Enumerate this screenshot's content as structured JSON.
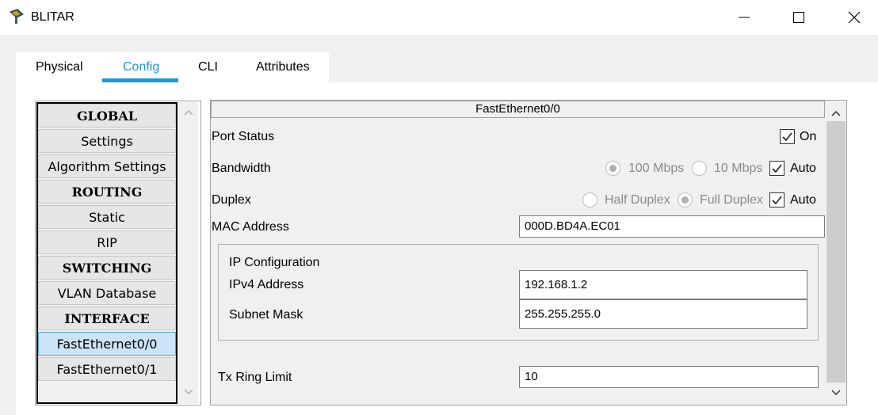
{
  "window": {
    "title": "BLITAR"
  },
  "tabs": [
    {
      "label": "Physical"
    },
    {
      "label": "Config"
    },
    {
      "label": "CLI"
    },
    {
      "label": "Attributes"
    }
  ],
  "active_tab": "Config",
  "sidebar": {
    "items": [
      {
        "label": "GLOBAL",
        "kind": "header"
      },
      {
        "label": "Settings",
        "kind": "item"
      },
      {
        "label": "Algorithm Settings",
        "kind": "item"
      },
      {
        "label": "ROUTING",
        "kind": "header"
      },
      {
        "label": "Static",
        "kind": "item"
      },
      {
        "label": "RIP",
        "kind": "item"
      },
      {
        "label": "SWITCHING",
        "kind": "header"
      },
      {
        "label": "VLAN Database",
        "kind": "item"
      },
      {
        "label": "INTERFACE",
        "kind": "header"
      },
      {
        "label": "FastEthernet0/0",
        "kind": "item",
        "selected": true
      },
      {
        "label": "FastEthernet0/1",
        "kind": "item"
      }
    ]
  },
  "panel": {
    "title": "FastEthernet0/0",
    "port_status": {
      "label": "Port Status",
      "on_label": "On",
      "on_checked": true
    },
    "bandwidth": {
      "label": "Bandwidth",
      "opt1": "100 Mbps",
      "opt2": "10 Mbps",
      "auto_label": "Auto",
      "auto_checked": true,
      "selected": "100 Mbps"
    },
    "duplex": {
      "label": "Duplex",
      "opt1": "Half Duplex",
      "opt2": "Full Duplex",
      "auto_label": "Auto",
      "auto_checked": true,
      "selected": "Full Duplex"
    },
    "mac": {
      "label": "MAC Address",
      "value": "000D.BD4A.EC01"
    },
    "ip_config": {
      "title": "IP Configuration",
      "ipv4_label": "IPv4 Address",
      "ipv4_value": "192.168.1.2",
      "mask_label": "Subnet Mask",
      "mask_value": "255.255.255.0"
    },
    "tx_ring": {
      "label": "Tx Ring Limit",
      "value": "10"
    }
  },
  "colors": {
    "accent": "#1a9bd7",
    "selected_item_bg": "#cce4f7"
  }
}
